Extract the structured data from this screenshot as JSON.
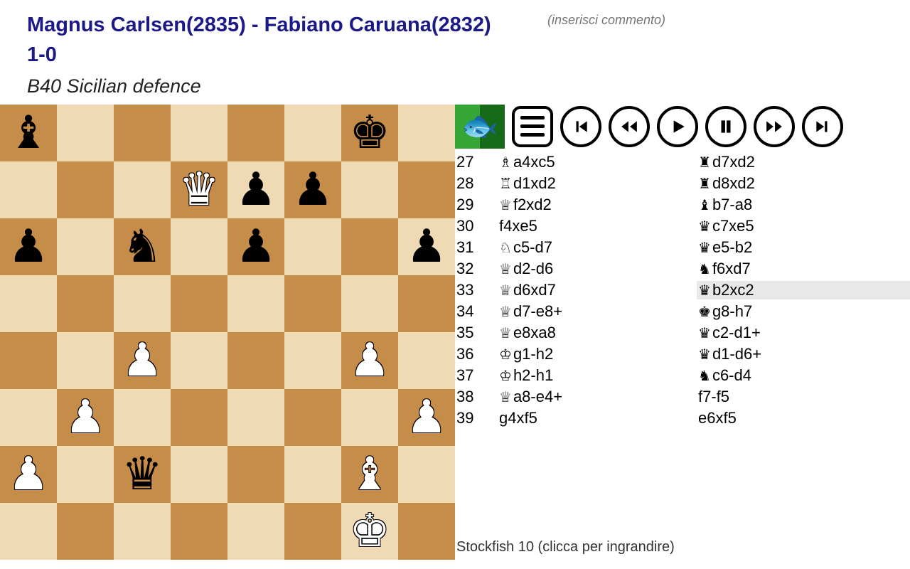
{
  "header": {
    "players": "Magnus Carlsen(2835) - Fabiano Caruana(2832)",
    "result": "1-0",
    "opening": "B40 Sicilian defence"
  },
  "comment_placeholder": "(inserisci commento)",
  "engine_line": "Stockfish 10 (clicca per ingrandire)",
  "board": {
    "light": "#f0dab5",
    "dark": "#c68d4a",
    "pieces": [
      {
        "sq": "a8",
        "p": "b"
      },
      {
        "sq": "g8",
        "p": "k"
      },
      {
        "sq": "d7",
        "p": "Q"
      },
      {
        "sq": "e7",
        "p": "p"
      },
      {
        "sq": "f7",
        "p": "p"
      },
      {
        "sq": "a6",
        "p": "p"
      },
      {
        "sq": "c6",
        "p": "n"
      },
      {
        "sq": "e6",
        "p": "p"
      },
      {
        "sq": "h6",
        "p": "p"
      },
      {
        "sq": "c4",
        "p": "P"
      },
      {
        "sq": "g4",
        "p": "P"
      },
      {
        "sq": "b3",
        "p": "P"
      },
      {
        "sq": "h3",
        "p": "P"
      },
      {
        "sq": "a2",
        "p": "P"
      },
      {
        "sq": "c2",
        "p": "q"
      },
      {
        "sq": "g2",
        "p": "B"
      },
      {
        "sq": "g1",
        "p": "K"
      }
    ]
  },
  "piece_glyph": {
    "K": "♔",
    "Q": "♕",
    "R": "♖",
    "B": "♗",
    "N": "♘",
    "P": "♙",
    "k": "♚",
    "q": "♛",
    "r": "♜",
    "b": "♝",
    "n": "♞",
    "p": "♟"
  },
  "move_glyph": {
    "K": "♔",
    "Q": "♕",
    "R": "♖",
    "B": "♗",
    "N": "♘"
  },
  "moves": [
    {
      "n": 27,
      "w": {
        "p": "B",
        "t": "a4xc5"
      },
      "b": {
        "p": "r",
        "t": "d7xd2"
      }
    },
    {
      "n": 28,
      "w": {
        "p": "R",
        "t": "d1xd2"
      },
      "b": {
        "p": "r",
        "t": "d8xd2"
      }
    },
    {
      "n": 29,
      "w": {
        "p": "Q",
        "t": "f2xd2"
      },
      "b": {
        "p": "b",
        "t": "b7-a8"
      }
    },
    {
      "n": 30,
      "w": {
        "p": "",
        "t": "f4xe5"
      },
      "b": {
        "p": "q",
        "t": "c7xe5"
      }
    },
    {
      "n": 31,
      "w": {
        "p": "N",
        "t": "c5-d7"
      },
      "b": {
        "p": "q",
        "t": "e5-b2"
      }
    },
    {
      "n": 32,
      "w": {
        "p": "Q",
        "t": "d2-d6"
      },
      "b": {
        "p": "n",
        "t": "f6xd7"
      }
    },
    {
      "n": 33,
      "w": {
        "p": "Q",
        "t": "d6xd7"
      },
      "b": {
        "p": "q",
        "t": "b2xc2"
      },
      "sel": true
    },
    {
      "n": 34,
      "w": {
        "p": "Q",
        "t": "d7-e8+"
      },
      "b": {
        "p": "k",
        "t": "g8-h7"
      }
    },
    {
      "n": 35,
      "w": {
        "p": "Q",
        "t": "e8xa8"
      },
      "b": {
        "p": "q",
        "t": "c2-d1+"
      }
    },
    {
      "n": 36,
      "w": {
        "p": "K",
        "t": "g1-h2"
      },
      "b": {
        "p": "q",
        "t": "d1-d6+"
      }
    },
    {
      "n": 37,
      "w": {
        "p": "K",
        "t": "h2-h1"
      },
      "b": {
        "p": "n",
        "t": "c6-d4"
      }
    },
    {
      "n": 38,
      "w": {
        "p": "Q",
        "t": "a8-e4+"
      },
      "b": {
        "p": "",
        "t": "f7-f5"
      }
    },
    {
      "n": 39,
      "w": {
        "p": "",
        "t": "g4xf5"
      },
      "b": {
        "p": "",
        "t": "e6xf5"
      }
    }
  ]
}
